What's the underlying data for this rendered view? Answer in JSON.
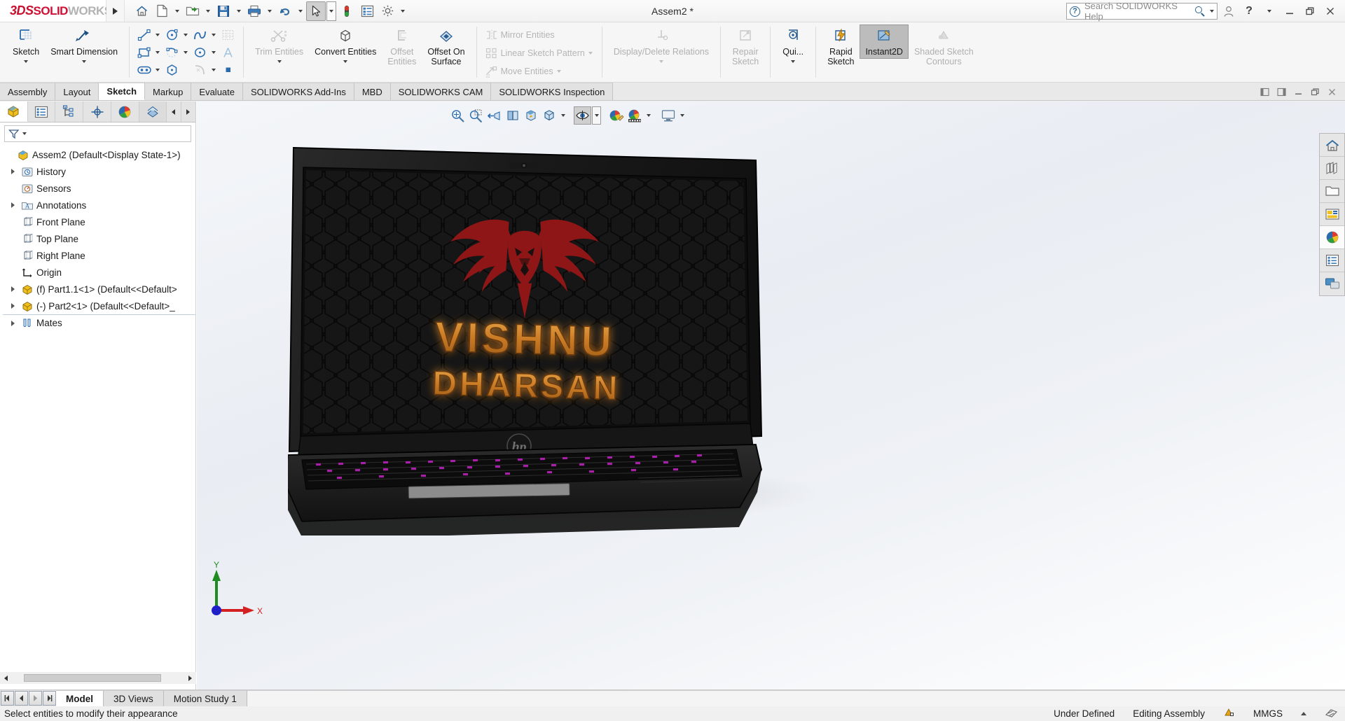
{
  "titlebar": {
    "brand": {
      "prefix": "3DS",
      "solid": "SOLID",
      "works": "WORKS"
    },
    "document_title": "Assem2 *",
    "quick_access": [
      {
        "name": "home-icon",
        "label": "Home",
        "dropdown": false
      },
      {
        "name": "new-document-icon",
        "label": "New",
        "dropdown": true
      },
      {
        "name": "open-folder-icon",
        "label": "Open",
        "dropdown": true
      },
      {
        "name": "save-icon",
        "label": "Save",
        "dropdown": true
      },
      {
        "name": "print-icon",
        "label": "Print",
        "dropdown": true
      },
      {
        "name": "undo-icon",
        "label": "Undo",
        "dropdown": true
      },
      {
        "name": "select-cursor-icon",
        "label": "Select",
        "dropdown": true,
        "selected": true
      },
      {
        "name": "rebuild-icon",
        "label": "Rebuild",
        "dropdown": false
      },
      {
        "name": "file-properties-icon",
        "label": "File Properties",
        "dropdown": false
      },
      {
        "name": "options-gear-icon",
        "label": "Options",
        "dropdown": true
      }
    ],
    "help_search": {
      "placeholder": "Search SOLIDWORKS Help"
    },
    "right_buttons": [
      {
        "name": "user-account-icon",
        "label": "Account"
      },
      {
        "name": "help-question-icon",
        "label": "Help"
      },
      {
        "name": "minimize-icon",
        "label": "Minimize"
      },
      {
        "name": "restore-icon",
        "label": "Restore"
      },
      {
        "name": "close-icon",
        "label": "Close"
      }
    ]
  },
  "ribbon": {
    "groups": [
      {
        "kind": "big",
        "items": [
          {
            "label": "Sketch",
            "icon": "sketch-icon",
            "dropdown": true,
            "disabled": false,
            "selected": false
          },
          {
            "label": "Smart Dimension",
            "icon": "smart-dimension-icon",
            "dropdown": true,
            "disabled": false,
            "selected": false
          }
        ]
      },
      {
        "kind": "small",
        "items": [
          {
            "label": "",
            "icon": "line-icon",
            "dropdown": true,
            "disabled": false
          },
          {
            "label": "",
            "icon": "rectangle-icon",
            "dropdown": true,
            "disabled": false
          },
          {
            "label": "",
            "icon": "slot-icon",
            "dropdown": true,
            "disabled": false
          },
          {
            "label": "",
            "icon": "circle-icon",
            "dropdown": true,
            "disabled": false
          },
          {
            "label": "",
            "icon": "arc-icon",
            "dropdown": true,
            "disabled": false
          },
          {
            "label": "",
            "icon": "polygon-icon",
            "dropdown": false,
            "disabled": false
          },
          {
            "label": "",
            "icon": "spline-icon",
            "dropdown": true,
            "disabled": false
          },
          {
            "label": "",
            "icon": "ellipse-icon",
            "dropdown": true,
            "disabled": false
          },
          {
            "label": "",
            "icon": "fillet-icon",
            "dropdown": true,
            "disabled": true
          },
          {
            "label": "",
            "icon": "sketch-pattern-icon",
            "dropdown": false,
            "disabled": true
          },
          {
            "label": "",
            "icon": "text-icon",
            "dropdown": false,
            "disabled": true
          },
          {
            "label": "",
            "icon": "point-icon",
            "dropdown": false,
            "disabled": false
          }
        ]
      },
      {
        "kind": "big",
        "items": [
          {
            "label": "Trim Entities",
            "icon": "trim-entities-icon",
            "dropdown": true,
            "disabled": true
          },
          {
            "label": "Convert Entities",
            "icon": "convert-entities-icon",
            "dropdown": true,
            "disabled": false
          },
          {
            "label": "Offset\nEntities",
            "icon": "offset-entities-icon",
            "dropdown": false,
            "disabled": true
          },
          {
            "label": "Offset On\nSurface",
            "icon": "offset-on-surface-icon",
            "dropdown": false,
            "disabled": false
          }
        ]
      },
      {
        "kind": "small",
        "items": [
          {
            "label": "Mirror Entities",
            "icon": "mirror-entities-icon",
            "dropdown": false,
            "disabled": true
          },
          {
            "label": "Linear Sketch Pattern",
            "icon": "linear-sketch-pattern-icon",
            "dropdown": true,
            "disabled": true
          },
          {
            "label": "Move Entities",
            "icon": "move-entities-icon",
            "dropdown": true,
            "disabled": true
          }
        ]
      },
      {
        "kind": "big",
        "items": [
          {
            "label": "Display/Delete Relations",
            "icon": "display-delete-relations-icon",
            "dropdown": true,
            "disabled": true
          },
          {
            "label": "Repair\nSketch",
            "icon": "repair-sketch-icon",
            "dropdown": false,
            "disabled": true
          },
          {
            "label": "Qui...",
            "icon": "quick-snaps-icon",
            "dropdown": true,
            "disabled": false
          },
          {
            "label": "Rapid\nSketch",
            "icon": "rapid-sketch-icon",
            "dropdown": false,
            "disabled": false
          },
          {
            "label": "Instant2D",
            "icon": "instant2d-icon",
            "dropdown": false,
            "disabled": false,
            "selected": true
          },
          {
            "label": "Shaded Sketch\nContours",
            "icon": "shaded-sketch-contours-icon",
            "dropdown": false,
            "disabled": true
          }
        ]
      }
    ]
  },
  "command_tabs": {
    "tabs": [
      {
        "label": "Assembly",
        "active": false
      },
      {
        "label": "Layout",
        "active": false
      },
      {
        "label": "Sketch",
        "active": true
      },
      {
        "label": "Markup",
        "active": false
      },
      {
        "label": "Evaluate",
        "active": false
      },
      {
        "label": "SOLIDWORKS Add-Ins",
        "active": false
      },
      {
        "label": "MBD",
        "active": false
      },
      {
        "label": "SOLIDWORKS CAM",
        "active": false
      },
      {
        "label": "SOLIDWORKS Inspection",
        "active": false
      }
    ],
    "window_buttons": [
      {
        "name": "pin-left-icon",
        "label": "Pin Left"
      },
      {
        "name": "pin-right-icon",
        "label": "Pin Right"
      },
      {
        "name": "doc-minimize-icon",
        "label": "Minimize"
      },
      {
        "name": "doc-restore-icon",
        "label": "Restore"
      },
      {
        "name": "doc-close-icon",
        "label": "Close"
      }
    ]
  },
  "sidebar": {
    "tabs": [
      {
        "name": "feature-manager-tab",
        "icon": "feature-tree-icon",
        "active": true
      },
      {
        "name": "property-manager-tab",
        "icon": "property-list-icon",
        "active": false
      },
      {
        "name": "configuration-manager-tab",
        "icon": "configuration-icon",
        "active": false
      },
      {
        "name": "dimxpert-manager-tab",
        "icon": "dimxpert-icon",
        "active": false
      },
      {
        "name": "display-manager-tab",
        "icon": "appearance-sphere-icon",
        "active": false
      },
      {
        "name": "render-manager-tab",
        "icon": "render-icon",
        "active": false
      }
    ],
    "filter": {
      "name": "filter-icon",
      "placeholder": ""
    },
    "tree": [
      {
        "label": "Assem2  (Default<Display State-1>)",
        "icon": "assembly-icon",
        "indent": 0,
        "expandable": false,
        "root": true
      },
      {
        "label": "History",
        "icon": "history-icon",
        "indent": 1,
        "expandable": true
      },
      {
        "label": "Sensors",
        "icon": "sensors-icon",
        "indent": 1,
        "expandable": false
      },
      {
        "label": "Annotations",
        "icon": "annotations-icon",
        "indent": 1,
        "expandable": true
      },
      {
        "label": "Front Plane",
        "icon": "plane-icon",
        "indent": 1,
        "expandable": false
      },
      {
        "label": "Top Plane",
        "icon": "plane-icon",
        "indent": 1,
        "expandable": false
      },
      {
        "label": "Right Plane",
        "icon": "plane-icon",
        "indent": 1,
        "expandable": false
      },
      {
        "label": "Origin",
        "icon": "origin-icon",
        "indent": 1,
        "expandable": false
      },
      {
        "label": "(f) Part1.1<1>  (Default<<Default>",
        "icon": "part-icon",
        "indent": 1,
        "expandable": true
      },
      {
        "label": "(-) Part2<1>  (Default<<Default>_",
        "icon": "part-icon",
        "indent": 1,
        "expandable": true
      },
      {
        "label": "Mates",
        "icon": "mates-icon",
        "indent": 1,
        "expandable": true,
        "divider": true
      }
    ]
  },
  "graphics": {
    "view_toolbar": [
      {
        "name": "zoom-to-fit-icon",
        "label": "Zoom to Fit",
        "dropdown": false
      },
      {
        "name": "zoom-to-area-icon",
        "label": "Zoom to Area",
        "dropdown": false
      },
      {
        "name": "previous-view-icon",
        "label": "Previous View",
        "dropdown": false
      },
      {
        "name": "section-view-icon",
        "label": "Section View",
        "dropdown": false
      },
      {
        "name": "view-orientation-icon",
        "label": "View Orientation",
        "dropdown": false
      },
      {
        "name": "display-style-icon",
        "label": "Display Style",
        "dropdown": true
      },
      {
        "name": "hide-show-items-icon",
        "label": "Hide/Show Items",
        "dropdown": true,
        "selected": true
      },
      {
        "name": "edit-appearance-icon",
        "label": "Edit Appearance",
        "dropdown": false
      },
      {
        "name": "apply-scene-icon",
        "label": "Apply Scene",
        "dropdown": true
      },
      {
        "name": "view-settings-icon",
        "label": "View Settings",
        "dropdown": true
      }
    ],
    "right_toolbar": [
      {
        "name": "view-home-icon",
        "label": "Home"
      },
      {
        "name": "appearances-library-icon",
        "label": "Appearances"
      },
      {
        "name": "file-explorer-icon",
        "label": "File Explorer"
      },
      {
        "name": "view-palette-icon",
        "label": "View Palette"
      },
      {
        "name": "appearances-sphere-icon",
        "label": "Appearances, Scenes and Decals",
        "highlight": true
      },
      {
        "name": "custom-properties-icon",
        "label": "Custom Properties"
      },
      {
        "name": "design-library-icon",
        "label": "Design Library"
      }
    ],
    "triad": {
      "x_label": "X",
      "y_label": "Y",
      "x_color": "#d42020",
      "y_color": "#1f8c1f",
      "z_color": "#2020c8"
    },
    "model": {
      "name": "hp-gaming-laptop-assembly",
      "screen_wallpaper": {
        "logo_name": "winged-wolf-head-logo",
        "logo_color": "#8e1616",
        "text_line1": "VISHNU",
        "text_line2": "DHARSAN",
        "text_color": "#d4822a",
        "background": "#1a1a1a",
        "pattern": "hexagon-honeycomb"
      },
      "brand_badge": "hp",
      "keyboard_backlight_color": "#a820a8",
      "body_color": "#1c1c1c"
    }
  },
  "bottom": {
    "nav_buttons": [
      {
        "name": "first-tab-icon",
        "label": "First"
      },
      {
        "name": "prev-tab-icon",
        "label": "Previous"
      },
      {
        "name": "next-tab-icon",
        "label": "Next"
      },
      {
        "name": "last-tab-icon",
        "label": "Last"
      }
    ],
    "tabs": [
      {
        "label": "Model",
        "active": true
      },
      {
        "label": "3D Views",
        "active": false
      },
      {
        "label": "Motion Study 1",
        "active": false
      }
    ],
    "status_message": "Select entities to modify their appearance",
    "status_right": [
      {
        "name": "status-under-defined",
        "label": "Under Defined"
      },
      {
        "name": "status-editing-mode",
        "label": "Editing Assembly"
      },
      {
        "name": "status-overlay-icon",
        "label": ""
      },
      {
        "name": "status-units",
        "label": "MMGS"
      },
      {
        "name": "status-units-caret",
        "label": ""
      },
      {
        "name": "status-expand-icon",
        "label": ""
      }
    ]
  }
}
